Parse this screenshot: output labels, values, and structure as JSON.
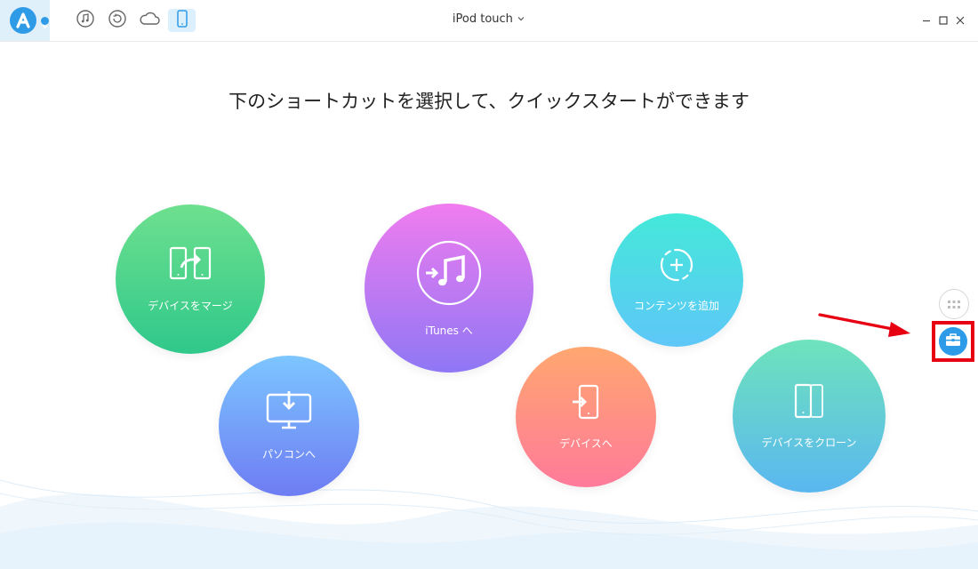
{
  "toolbar": {
    "device_name": "iPod touch",
    "buttons": [
      "music-icon",
      "backup-icon",
      "cloud-icon",
      "device-icon"
    ]
  },
  "main": {
    "heading": "下のショートカットを選択して、クイックスタートができます"
  },
  "shortcuts": [
    {
      "id": "merge",
      "label": "デバイスをマージ",
      "icon": "merge-devices-icon"
    },
    {
      "id": "pc",
      "label": "パソコンへ",
      "icon": "computer-icon"
    },
    {
      "id": "itunes",
      "label": "iTunes へ",
      "icon": "itunes-icon"
    },
    {
      "id": "content",
      "label": "コンテンツを追加",
      "icon": "add-content-icon"
    },
    {
      "id": "device",
      "label": "デバイスへ",
      "icon": "to-device-icon"
    },
    {
      "id": "clone",
      "label": "デバイスをクローン",
      "icon": "clone-device-icon"
    }
  ],
  "colors": {
    "accent": "#2f9be6",
    "highlight": "#e60012"
  }
}
